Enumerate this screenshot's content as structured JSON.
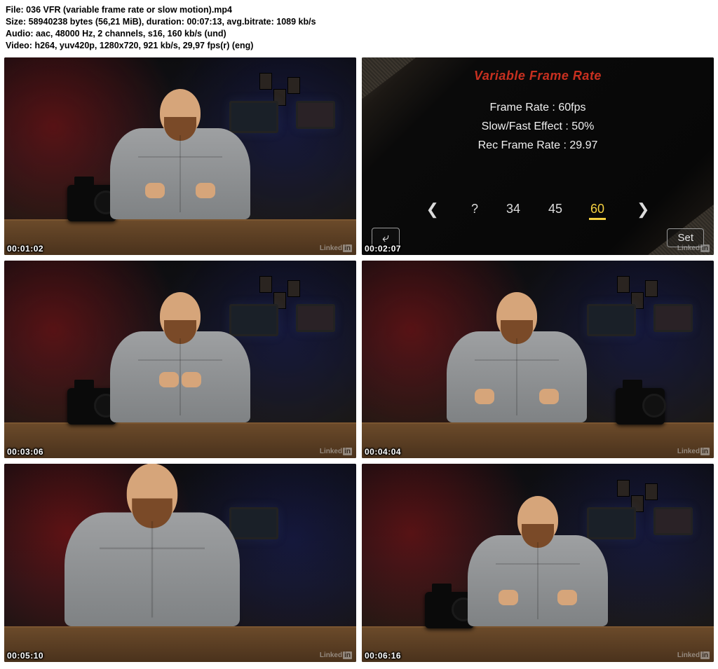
{
  "meta": {
    "file_label": "File: ",
    "file_value": "036 VFR (variable frame rate or slow motion).mp4",
    "size_label": "Size: ",
    "size_value": "58940238 bytes (56,21 MiB), duration: 00:07:13, avg.bitrate: 1089 kb/s",
    "audio_label": "Audio: ",
    "audio_value": "aac, 48000 Hz, 2 channels, s16, 160 kb/s (und)",
    "video_label": "Video: ",
    "video_value": "h264, yuv420p, 1280x720, 921 kb/s, 29,97 fps(r) (eng)"
  },
  "watermark": "Linked",
  "watermark_in": "in",
  "thumbs": [
    {
      "timecode": "00:01:02"
    },
    {
      "timecode": "00:02:07"
    },
    {
      "timecode": "00:03:06"
    },
    {
      "timecode": "00:04:04"
    },
    {
      "timecode": "00:05:10"
    },
    {
      "timecode": "00:06:16"
    }
  ],
  "menu": {
    "title": "Variable Frame Rate",
    "line1": "Frame Rate : 60fps",
    "line2": "Slow/Fast Effect : 50%",
    "line3": "Rec Frame Rate : 29.97",
    "options": {
      "leftmost": "?",
      "a": "34",
      "b": "45",
      "c": "60"
    },
    "back_icon": "⤶",
    "set_label": "Set"
  }
}
